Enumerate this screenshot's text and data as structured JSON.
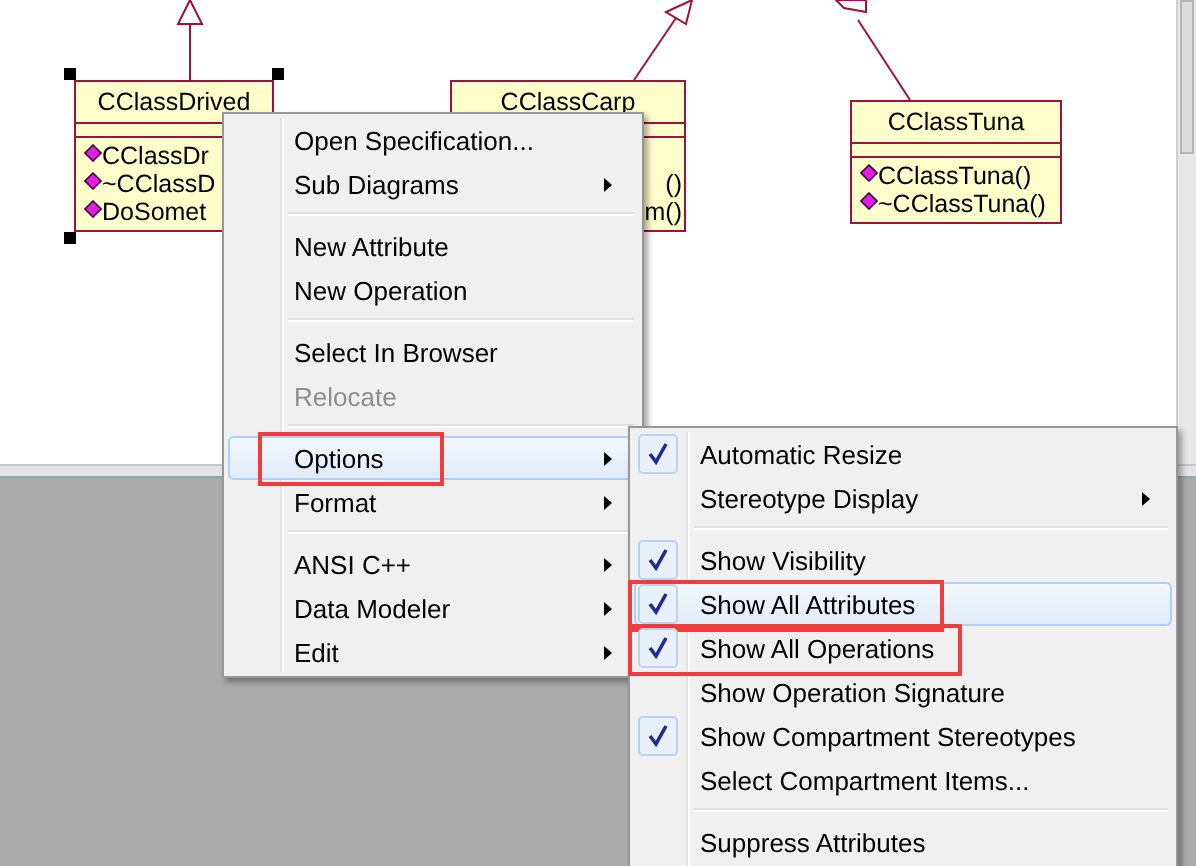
{
  "diagram": {
    "classes": [
      {
        "name": "CClassDrived",
        "selected": true,
        "partly_hidden": false,
        "operations": [
          "CClassDr",
          "~CClassD",
          "DoSomet"
        ]
      },
      {
        "name": "CClassCarp",
        "selected": false,
        "partly_hidden": true,
        "operations": [
          "()",
          "m()"
        ]
      },
      {
        "name": "CClassTuna",
        "selected": false,
        "partly_hidden": false,
        "operations": [
          "CClassTuna()",
          "~CClassTuna()"
        ]
      }
    ]
  },
  "context_menu": {
    "items": [
      {
        "kind": "item",
        "label": "Open Specification...",
        "disabled": false,
        "submenu": false,
        "selected": false,
        "annotated": false
      },
      {
        "kind": "item",
        "label": "Sub Diagrams",
        "disabled": false,
        "submenu": true,
        "selected": false,
        "annotated": false
      },
      {
        "kind": "separator"
      },
      {
        "kind": "item",
        "label": "New Attribute",
        "disabled": false,
        "submenu": false,
        "selected": false,
        "annotated": false
      },
      {
        "kind": "item",
        "label": "New Operation",
        "disabled": false,
        "submenu": false,
        "selected": false,
        "annotated": false
      },
      {
        "kind": "separator"
      },
      {
        "kind": "item",
        "label": "Select In Browser",
        "disabled": false,
        "submenu": false,
        "selected": false,
        "annotated": false
      },
      {
        "kind": "item",
        "label": "Relocate",
        "disabled": true,
        "submenu": false,
        "selected": false,
        "annotated": false
      },
      {
        "kind": "separator"
      },
      {
        "kind": "item",
        "label": "Options",
        "disabled": false,
        "submenu": true,
        "selected": true,
        "annotated": true
      },
      {
        "kind": "item",
        "label": "Format",
        "disabled": false,
        "submenu": true,
        "selected": false,
        "annotated": false
      },
      {
        "kind": "separator"
      },
      {
        "kind": "item",
        "label": "ANSI C++",
        "disabled": false,
        "submenu": true,
        "selected": false,
        "annotated": false
      },
      {
        "kind": "item",
        "label": "Data Modeler",
        "disabled": false,
        "submenu": true,
        "selected": false,
        "annotated": false
      },
      {
        "kind": "item",
        "label": "Edit",
        "disabled": false,
        "submenu": true,
        "selected": false,
        "annotated": false
      }
    ]
  },
  "options_submenu": {
    "items": [
      {
        "kind": "item",
        "label": "Automatic Resize",
        "checked": true,
        "submenu": false,
        "selected": false,
        "annotated": false
      },
      {
        "kind": "item",
        "label": "Stereotype Display",
        "checked": false,
        "submenu": true,
        "selected": false,
        "annotated": false
      },
      {
        "kind": "separator"
      },
      {
        "kind": "item",
        "label": "Show Visibility",
        "checked": true,
        "submenu": false,
        "selected": false,
        "annotated": false
      },
      {
        "kind": "item",
        "label": "Show All Attributes",
        "checked": true,
        "submenu": false,
        "selected": true,
        "annotated": true
      },
      {
        "kind": "item",
        "label": "Show All Operations",
        "checked": true,
        "submenu": false,
        "selected": false,
        "annotated": true
      },
      {
        "kind": "item",
        "label": "Show Operation Signature",
        "checked": false,
        "submenu": false,
        "selected": false,
        "annotated": false
      },
      {
        "kind": "item",
        "label": "Show Compartment Stereotypes",
        "checked": true,
        "submenu": false,
        "selected": false,
        "annotated": false
      },
      {
        "kind": "item",
        "label": "Select Compartment Items...",
        "checked": false,
        "submenu": false,
        "selected": false,
        "annotated": false
      },
      {
        "kind": "separator"
      },
      {
        "kind": "item",
        "label": "Suppress Attributes",
        "checked": false,
        "submenu": false,
        "selected": false,
        "annotated": false
      }
    ]
  }
}
